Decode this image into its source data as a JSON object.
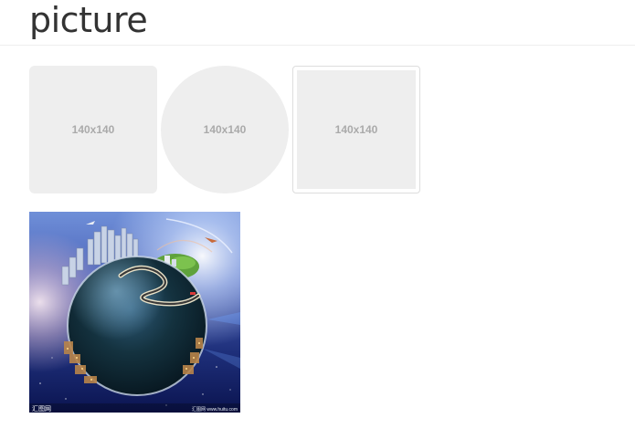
{
  "page": {
    "title": "picture"
  },
  "placeholders": {
    "rounded": {
      "label": "140x140"
    },
    "circle": {
      "label": "140x140"
    },
    "thumbnail": {
      "label": "140x140"
    }
  },
  "photo": {
    "watermark_logo": "汇图网",
    "watermark_right": "汇图网 www.huitu.com"
  },
  "colors": {
    "placeholder_bg": "#eeeeee",
    "placeholder_text": "#aaaaaa",
    "divider": "#eeeeee",
    "thumbnail_border": "#dddddd"
  }
}
